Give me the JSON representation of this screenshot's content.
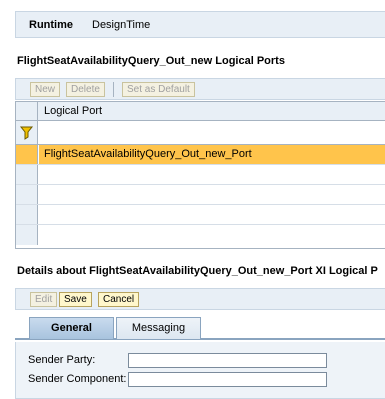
{
  "top_tabs": {
    "runtime": "Runtime",
    "designtime": "DesignTime"
  },
  "ports_section": {
    "title": "FlightSeatAvailabilityQuery_Out_new Logical Ports"
  },
  "ports_toolbar": {
    "new_label": "New",
    "delete_label": "Delete",
    "set_default_label": "Set as Default"
  },
  "ports_table": {
    "column_header": "Logical Port",
    "rows": [
      "FlightSeatAvailabilityQuery_Out_new_Port",
      "",
      "",
      "",
      ""
    ],
    "selected_row": 0
  },
  "details_section": {
    "title": "Details about FlightSeatAvailabilityQuery_Out_new_Port XI  Logical P"
  },
  "details_toolbar": {
    "edit_label": "Edit",
    "save_label": "Save",
    "cancel_label": "Cancel"
  },
  "details_tabs": {
    "general": "General",
    "messaging": "Messaging"
  },
  "form": {
    "sender_party_label": "Sender Party:",
    "sender_party_value": "",
    "sender_component_label": "Sender Component:",
    "sender_component_value": ""
  },
  "colors": {
    "selected_row": "#ffc44b",
    "button_bg": "#fff7cc",
    "header_bg": "#e8eff6"
  },
  "icons": {
    "filter": "funnel-icon"
  }
}
